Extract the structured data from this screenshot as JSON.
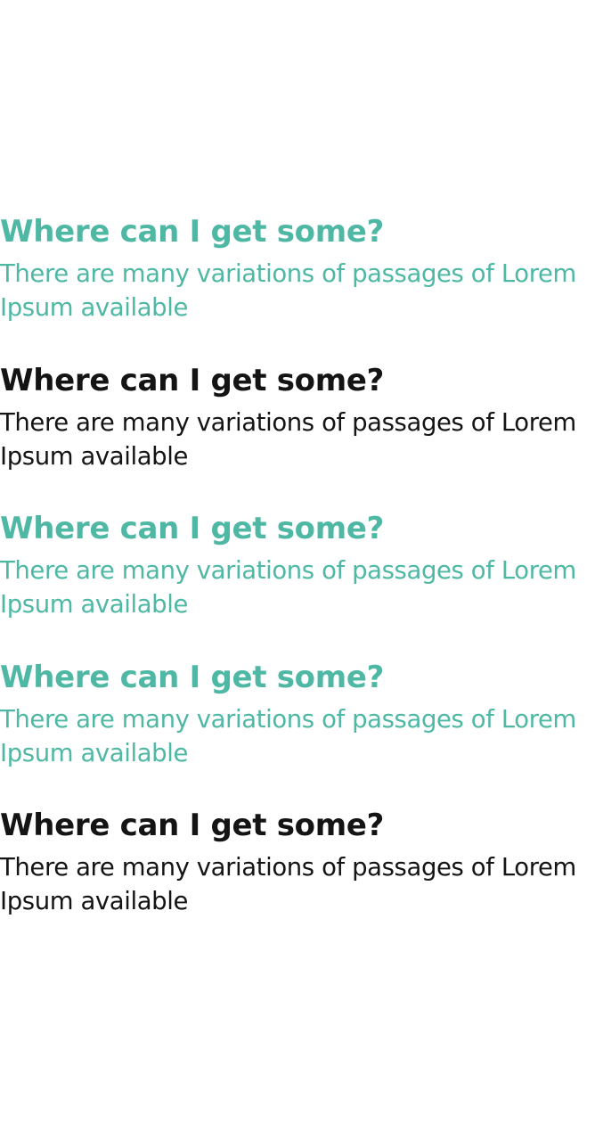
{
  "theme": {
    "accent": "#4fb8a4",
    "dark": "#141414"
  },
  "items": [
    {
      "title": "Where can I get some?",
      "text": "There are many variations of passages of Lorem Ipsum available",
      "color": "#4fb8a4"
    },
    {
      "title": "Where can I get some?",
      "text": "There are many variations of passages of Lorem Ipsum available",
      "color": "#141414"
    },
    {
      "title": "Where can I get some?",
      "text": "There are many variations of passages of Lorem Ipsum available",
      "color": "#4fb8a4"
    },
    {
      "title": "Where can I get some?",
      "text": "There are many variations of passages of Lorem Ipsum available",
      "color": "#4fb8a4"
    },
    {
      "title": "Where can I get some?",
      "text": "There are many variations of passages of Lorem Ipsum available",
      "color": "#141414"
    }
  ]
}
